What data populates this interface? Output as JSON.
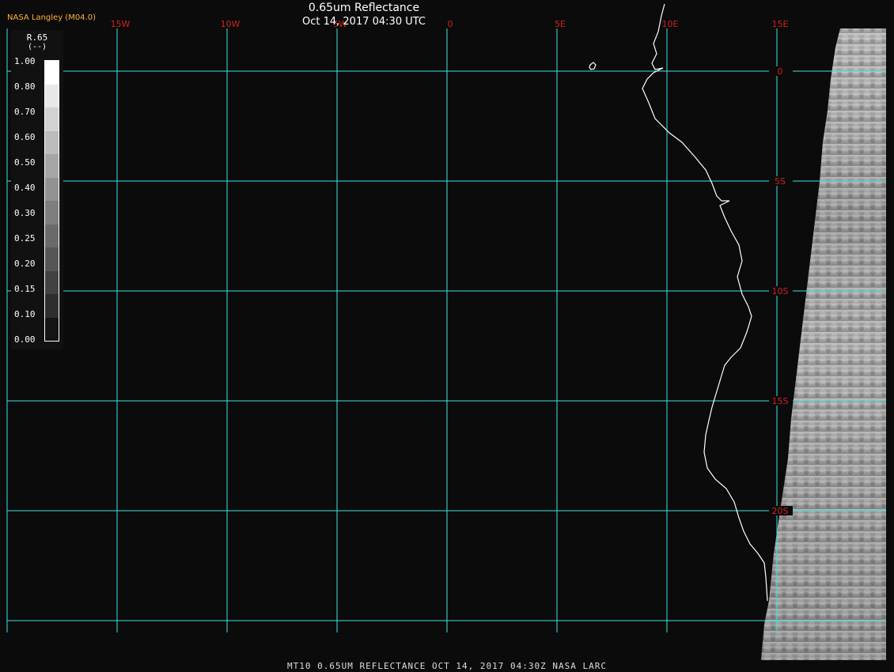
{
  "header": {
    "credit": "NASA Langley (M04.0)",
    "title": "0.65um Reflectance",
    "subtitle": "Oct 14, 2017 04:30 UTC"
  },
  "footer": {
    "text": "MT10  0.65UM REFLECTANCE  OCT 14, 2017 04:30Z  NASA LARC"
  },
  "legend": {
    "title": "R.65",
    "units": "(--)",
    "ticks": [
      "1.00",
      "0.80",
      "0.70",
      "0.60",
      "0.50",
      "0.40",
      "0.30",
      "0.25",
      "0.20",
      "0.15",
      "0.10",
      "0.00"
    ],
    "shades": [
      "#ffffff",
      "#e8e8e8",
      "#d2d2d2",
      "#bcbcbc",
      "#a6a6a6",
      "#929292",
      "#7e7e7e",
      "#6a6a6a",
      "#565656",
      "#424242",
      "#2e2e2e",
      "#141414"
    ]
  },
  "map": {
    "background": "#0b0b0b",
    "grid_color": "#3fe0e0",
    "label_color": "#d02020",
    "coast_color": "#ffffff",
    "lon_labels": [
      "15W",
      "10W",
      "5W",
      "0",
      "5E",
      "10E",
      "15E"
    ],
    "lat_labels": [
      "0",
      "5S",
      "10S",
      "15S",
      "20S"
    ]
  }
}
